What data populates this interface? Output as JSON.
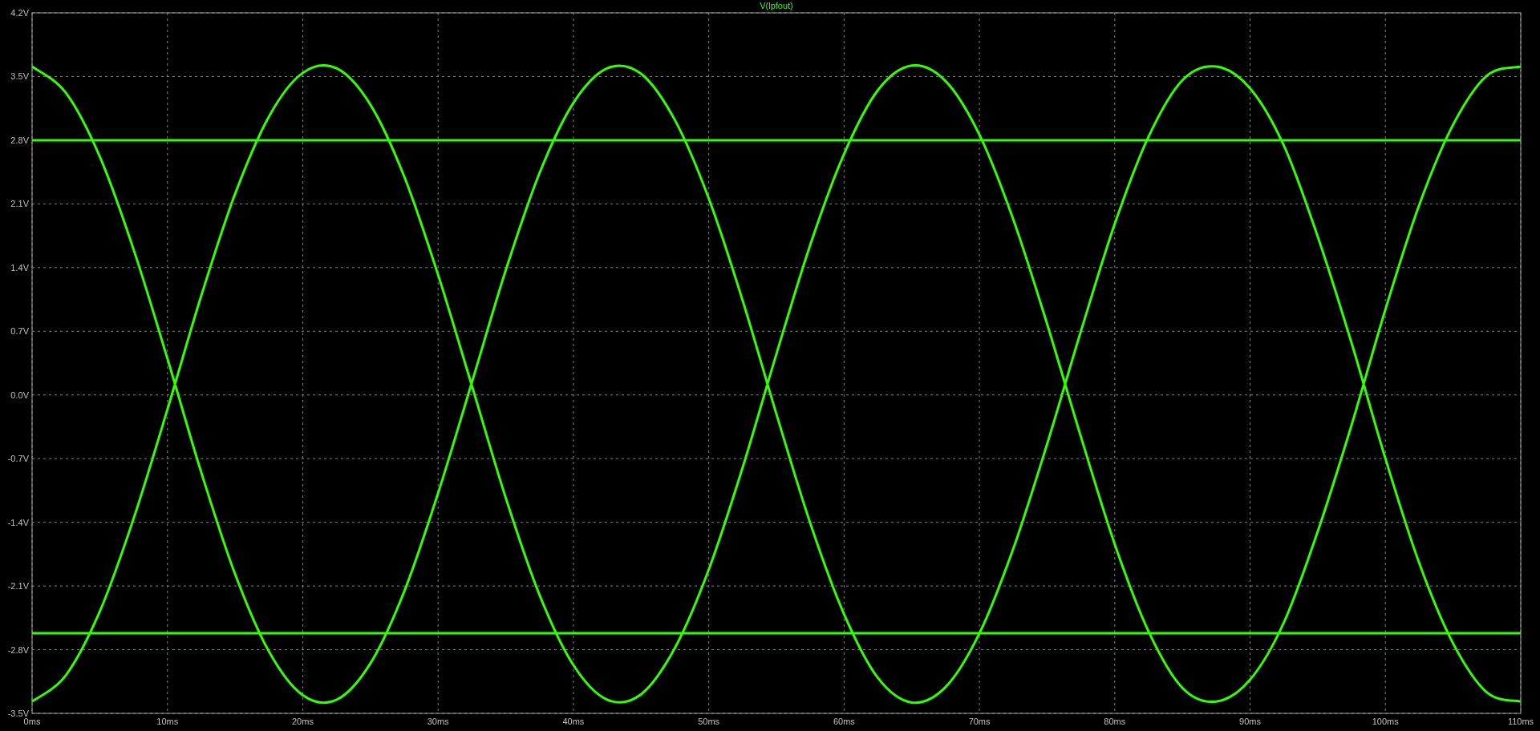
{
  "plot": {
    "chart_data": {
      "type": "line",
      "grid": true,
      "x": [
        0,
        2.5,
        5,
        7.5,
        10,
        12.5,
        15,
        17.5,
        20,
        22.5,
        25,
        27.5,
        30,
        32.5,
        35,
        37.5,
        40,
        42.5,
        45,
        47.5,
        50,
        52.5,
        55,
        57.5,
        60,
        62.5,
        65,
        67.5,
        70,
        72.5,
        75,
        77.5,
        80,
        82.5,
        85,
        87.5,
        90,
        92.5,
        95,
        97.5,
        100,
        102.5,
        105,
        107.5,
        110,
        null,
        0,
        2.5,
        5,
        7.5,
        10,
        12.5,
        15,
        17.5,
        20,
        22.5,
        25,
        27.5,
        30,
        32.5,
        35,
        37.5,
        40,
        42.5,
        45,
        47.5,
        50,
        52.5,
        55,
        57.5,
        60,
        62.5,
        65,
        67.5,
        70,
        72.5,
        75,
        77.5,
        80,
        82.5,
        85,
        87.5,
        90,
        92.5,
        95,
        97.5,
        100,
        102.5,
        105,
        107.5,
        110,
        null,
        0,
        10,
        20,
        30,
        40,
        50,
        60,
        70,
        80,
        90,
        100,
        110,
        null,
        0,
        10,
        20,
        30,
        40,
        50,
        60,
        70,
        80,
        90,
        100,
        110
      ],
      "xlim": [
        0,
        110
      ],
      "ylim": [
        -3.5,
        4.2
      ],
      "xticks": [
        {
          "value": 0,
          "label": "0ms"
        },
        {
          "value": 10,
          "label": "10ms"
        },
        {
          "value": 20,
          "label": "20ms"
        },
        {
          "value": 30,
          "label": "30ms"
        },
        {
          "value": 40,
          "label": "40ms"
        },
        {
          "value": 50,
          "label": "50ms"
        },
        {
          "value": 60,
          "label": "60ms"
        },
        {
          "value": 70,
          "label": "70ms"
        },
        {
          "value": 80,
          "label": "80ms"
        },
        {
          "value": 90,
          "label": "90ms"
        },
        {
          "value": 100,
          "label": "100ms"
        },
        {
          "value": 110,
          "label": "110ms"
        }
      ],
      "yticks": [
        {
          "value": 4.2,
          "label": "4.2V"
        },
        {
          "value": 3.5,
          "label": "3.5V"
        },
        {
          "value": 2.8,
          "label": "2.8V"
        },
        {
          "value": 2.1,
          "label": "2.1V"
        },
        {
          "value": 1.4,
          "label": "1.4V"
        },
        {
          "value": 0.7,
          "label": "0.7V"
        },
        {
          "value": 0,
          "label": "0.0V"
        },
        {
          "value": -0.7,
          "label": "-0.7V"
        },
        {
          "value": -1.4,
          "label": "-1.4V"
        },
        {
          "value": -2.1,
          "label": "-2.1V"
        },
        {
          "value": -2.8,
          "label": "-2.8V"
        },
        {
          "value": -3.5,
          "label": "-3.5V"
        }
      ],
      "series": [
        {
          "name": "V(lpfout)",
          "color": "#33ff00",
          "values": [
            -3.37,
            -3.08,
            -2.38,
            -1.36,
            -0.16,
            1.09,
            2.21,
            3.06,
            3.54,
            3.59,
            3.19,
            2.4,
            1.32,
            0.1,
            -1.13,
            -2.2,
            -2.97,
            -3.35,
            -3.29,
            -2.78,
            -1.92,
            -0.8,
            0.45,
            1.65,
            2.65,
            3.35,
            3.62,
            3.45,
            2.86,
            1.93,
            0.78,
            -0.46,
            -1.64,
            -2.6,
            -3.22,
            -3.37,
            -3.13,
            -2.5,
            -1.5,
            -0.33,
            0.94,
            2.09,
            2.97,
            3.51,
            3.61,
            null,
            3.61,
            3.32,
            2.62,
            1.6,
            0.4,
            -0.85,
            -1.97,
            -2.82,
            -3.3,
            -3.35,
            -2.95,
            -2.16,
            -1.08,
            0.14,
            1.37,
            2.44,
            3.21,
            3.59,
            3.53,
            3.02,
            2.16,
            1.04,
            -0.21,
            -1.41,
            -2.41,
            -3.11,
            -3.38,
            -3.21,
            -2.62,
            -1.69,
            -0.54,
            0.7,
            1.88,
            2.84,
            3.46,
            3.61,
            3.37,
            2.74,
            1.74,
            0.57,
            -0.7,
            -1.85,
            -2.73,
            -3.27,
            -3.37,
            null,
            2.8,
            2.8,
            2.8,
            2.8,
            2.8,
            2.8,
            2.8,
            2.8,
            2.8,
            2.8,
            2.8,
            2.8,
            null,
            -2.62,
            -2.62,
            -2.62,
            -2.62,
            -2.62,
            -2.62,
            -2.62,
            -2.62,
            -2.62,
            -2.62,
            -2.62,
            -2.62
          ]
        }
      ]
    }
  }
}
